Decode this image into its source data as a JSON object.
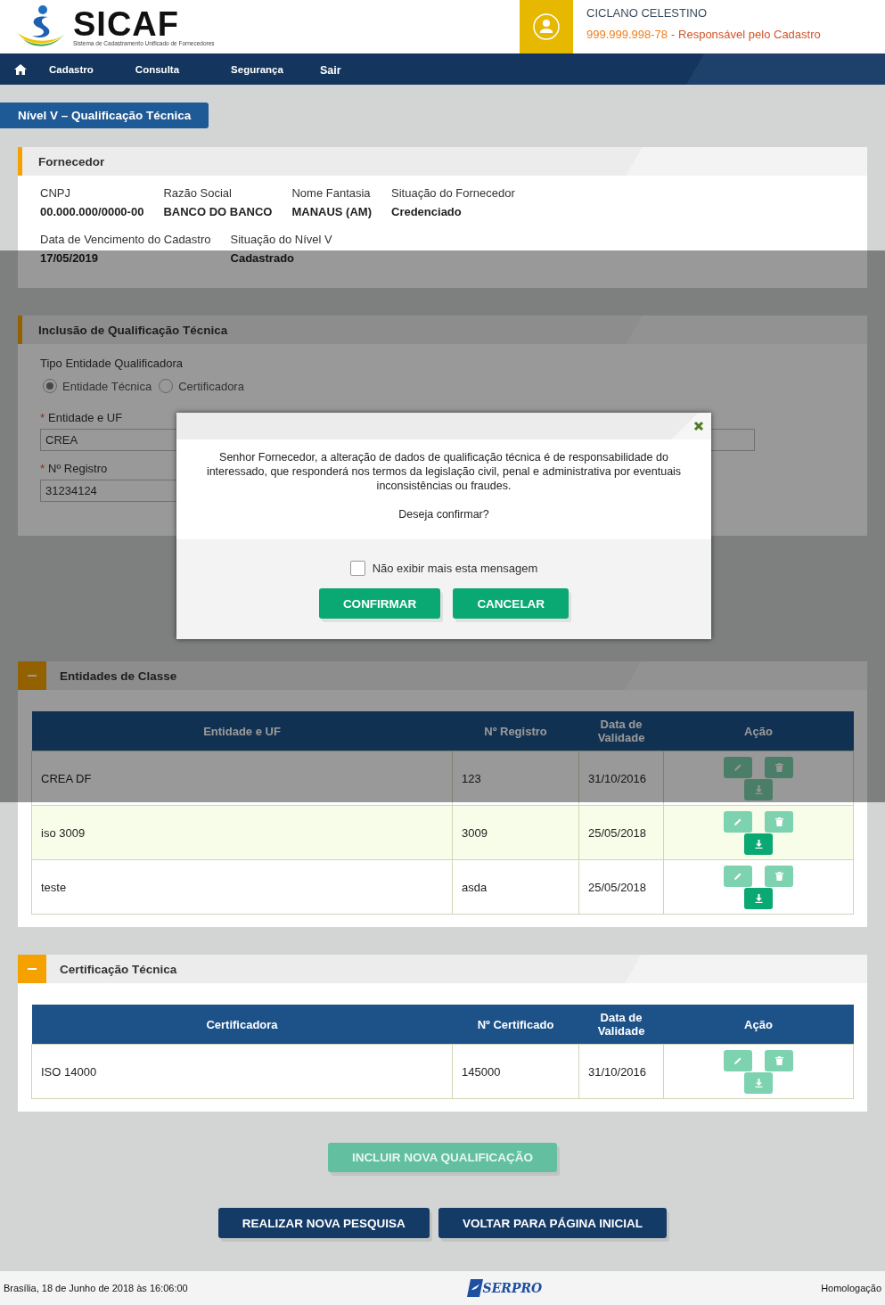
{
  "header": {
    "logo_text": "SICAF",
    "logo_subtitle": "Sistema de Cadastramento Unificado de Fornecedores",
    "user_name": "CICLANO CELESTINO",
    "user_cpf": "999.999.998-78",
    "user_role": "- Responsável pelo Cadastro"
  },
  "nav": [
    "Cadastro",
    "Consulta",
    "Segurança",
    "Sair"
  ],
  "level_tab": "Nível V – Qualificação Técnica",
  "fornecedor": {
    "title": "Fornecedor",
    "rows": [
      [
        {
          "label": "CNPJ",
          "value": "00.000.000/0000-00"
        },
        {
          "label": "Razão Social",
          "value": "BANCO DO BANCO"
        },
        {
          "label": "Nome Fantasia",
          "value": "MANAUS (AM)"
        },
        {
          "label": "Situação do Fornecedor",
          "value": "Credenciado"
        }
      ],
      [
        {
          "label": "Data de Vencimento do Cadastro",
          "value": "17/05/2019"
        },
        {
          "label": "Situação do Nível V",
          "value": "Cadastrado"
        }
      ]
    ]
  },
  "inclusao": {
    "title": "Inclusão de Qualificação Técnica",
    "type_label": "Tipo Entidade Qualificadora",
    "options": [
      {
        "label": "Entidade Técnica",
        "selected": true
      },
      {
        "label": "Certificadora",
        "selected": false
      }
    ],
    "fields": [
      {
        "mark": "*",
        "label": "Entidade e UF",
        "value": "CREA",
        "kind": "wide"
      },
      {
        "mark": "*",
        "label": "Nº Registro",
        "value": "31234124",
        "kind": "narrow"
      }
    ]
  },
  "entidades": {
    "title": "Entidades de Classe",
    "expanded": true,
    "columns": [
      "Entidade e UF",
      "Nº Registro",
      "Data de Validade",
      "Ação"
    ],
    "rows": [
      {
        "cells": [
          "CREA DF",
          "123",
          "31/10/2016"
        ],
        "selected": false,
        "download_enabled": false
      },
      {
        "cells": [
          "iso 3009",
          "3009",
          "25/05/2018"
        ],
        "selected": true,
        "download_enabled": true
      },
      {
        "cells": [
          "teste",
          "asda",
          "25/05/2018"
        ],
        "selected": false,
        "download_enabled": true
      }
    ]
  },
  "certificacao": {
    "title": "Certificação Técnica",
    "expanded": true,
    "columns": [
      "Certificadora",
      "Nº Certificado",
      "Data de Validade",
      "Ação"
    ],
    "rows": [
      {
        "cells": [
          "ISO 14000",
          "145000",
          "31/10/2016"
        ],
        "selected": false,
        "download_enabled": false
      }
    ]
  },
  "include_button": {
    "label": "INCLUIR NOVA QUALIFICAÇÃO",
    "disabled": true
  },
  "buttons": [
    "REALIZAR NOVA PESQUISA",
    "VOLTAR PARA PÁGINA INICIAL"
  ],
  "modal": {
    "message": "Senhor Fornecedor, a alteração de dados de qualificação técnica é de responsabilidade do interessado, que responderá nos termos da legislação civil, penal e administrativa por eventuais inconsistências ou fraudes.",
    "question": "Deseja confirmar?",
    "checkbox": {
      "label": "Não exibir mais esta mensagem",
      "checked": false
    },
    "buttons": [
      "CONFIRMAR",
      "CANCELAR"
    ]
  },
  "footer": {
    "date": "Brasília, 18 de Junho de 2018 às 16:06:00",
    "logo_text": "SERPRO",
    "environment": "Homologação"
  }
}
